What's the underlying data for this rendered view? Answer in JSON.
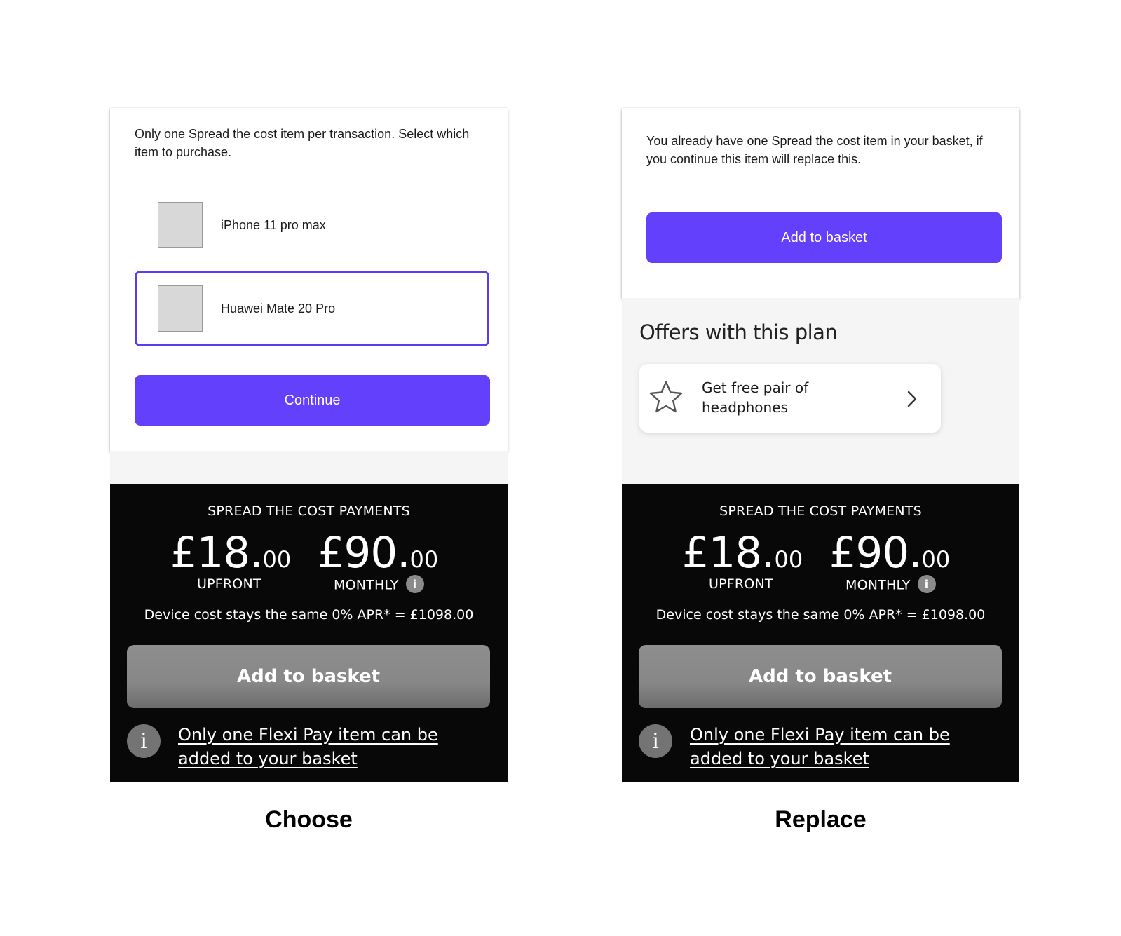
{
  "choose": {
    "message": "Only one Spread the cost item per transaction. Select which item to purchase.",
    "options": [
      {
        "label": "iPhone 11 pro max",
        "selected": false
      },
      {
        "label": "Huawei Mate 20 Pro",
        "selected": true
      }
    ],
    "continue_label": "Continue",
    "caption": "Choose"
  },
  "replace": {
    "message": "You already have one Spread the cost item in your basket, if you continue this item will replace this.",
    "add_label": "Add to basket",
    "offers_title": "Offers with this plan",
    "offer_text": "Get free pair of headphones",
    "offer_icon": "star-icon",
    "caption": "Replace"
  },
  "payments": {
    "title": "SPREAD THE COST PAYMENTS",
    "upfront_main": "£18.",
    "upfront_cents": "00",
    "upfront_label": "UPFRONT",
    "monthly_main": "£90.",
    "monthly_cents": "00",
    "monthly_label": "MONTHLY",
    "info_glyph": "i",
    "apr_line": "Device cost stays the same 0% APR* = £1098.00",
    "add_label": "Add to basket",
    "notice_text": "Only one Flexi Pay item can be added to your basket",
    "notice_icon": "info-icon"
  },
  "colors": {
    "accent": "#6340fb",
    "selected_border": "#5b3cf5",
    "dark_background": "#080808",
    "disabled_button": "#878787",
    "grey_background": "#f5f5f5"
  }
}
